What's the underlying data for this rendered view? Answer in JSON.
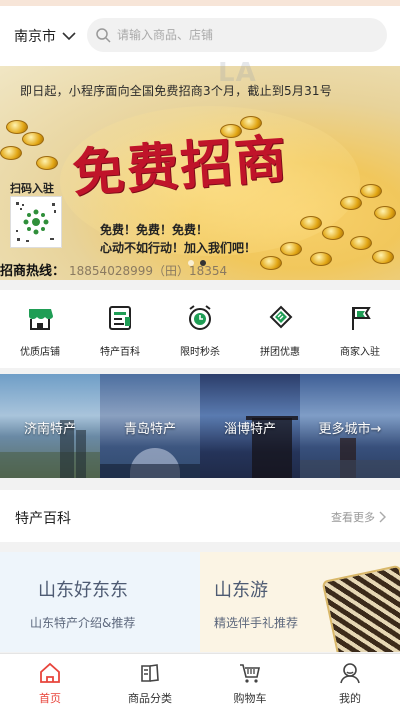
{
  "header": {
    "city": "南京市",
    "search_placeholder": "请输入商品、店铺"
  },
  "banner": {
    "top_text": "即日起，小程序面向全国免费招商3个月，截止到5月31号",
    "big_text": "免费招商",
    "qr_label": "扫码入驻",
    "slogan_line1": "免费！免费！免费！",
    "slogan_line2": "心动不如行动！加入我们吧！",
    "hotline_label": "招商热线：",
    "hotline_number": "18854028999（田）18354",
    "slide_count": 2,
    "active_slide": 2
  },
  "quick_nav": [
    {
      "label": "优质店铺",
      "icon": "store-icon"
    },
    {
      "label": "特产百科",
      "icon": "document-icon"
    },
    {
      "label": "限时秒杀",
      "icon": "alarm-clock-icon"
    },
    {
      "label": "拼团优惠",
      "icon": "ticket-icon"
    },
    {
      "label": "商家入驻",
      "icon": "flag-icon"
    }
  ],
  "cities": [
    {
      "label": "济南特产"
    },
    {
      "label": "青岛特产"
    },
    {
      "label": "淄博特产"
    },
    {
      "label": "更多城市→"
    }
  ],
  "section": {
    "title": "特产百科",
    "more": "查看更多"
  },
  "features": [
    {
      "title": "山东好东东",
      "subtitle": "山东特产介绍&推荐"
    },
    {
      "title": "山东游",
      "subtitle": "精选伴手礼推荐"
    }
  ],
  "watermark": "LA",
  "tabbar": [
    {
      "label": "首页",
      "icon": "home-icon",
      "active": true
    },
    {
      "label": "商品分类",
      "icon": "category-icon",
      "active": false
    },
    {
      "label": "购物车",
      "icon": "cart-icon",
      "active": false
    },
    {
      "label": "我的",
      "icon": "user-icon",
      "active": false
    }
  ],
  "colors": {
    "accent_green": "#1f9d55",
    "tab_active": "#e8453c",
    "banner_red": "#c0142a"
  }
}
